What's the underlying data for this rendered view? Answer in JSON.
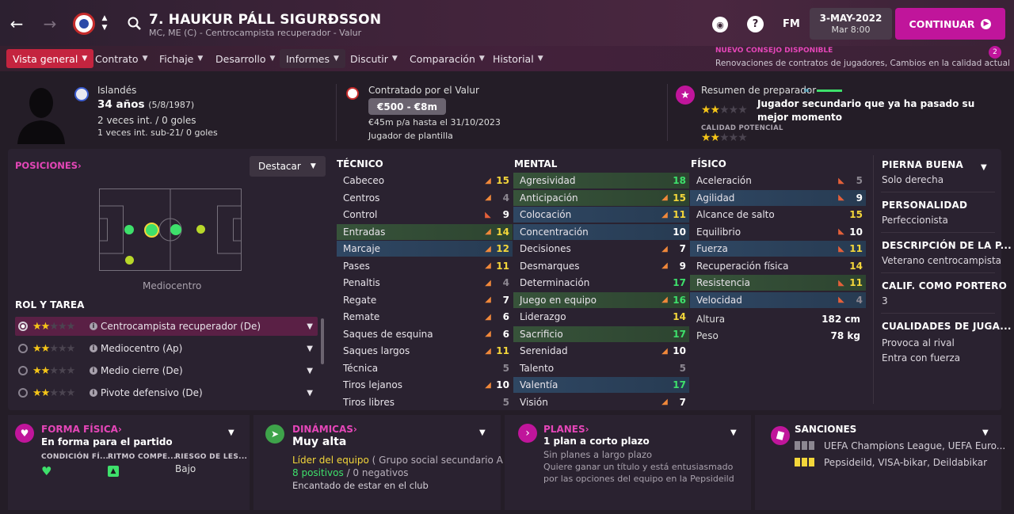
{
  "header": {
    "player_name": "7. HAUKUR PÁLL SIGURÐSSON",
    "subtitle": "MC, ME (C) - Centrocampista recuperador - Valur",
    "date": "3-MAY-2022",
    "time": "Mar 8:00",
    "fm_label": "FM",
    "continue_label": "CONTINUAR",
    "news_title": "NUEVO CONSEJO DISPONIBLE",
    "news_text": "Renovaciones de contratos de jugadores, Cambios en la calidad actual",
    "news_count": "2"
  },
  "nav": {
    "tabs": [
      "Vista general",
      "Contrato",
      "Fichaje",
      "Desarrollo",
      "Informes",
      "Discutir",
      "Comparación",
      "Historial"
    ]
  },
  "profile": {
    "nationality": "Islandés",
    "age": "34 años",
    "dob": "(5/8/1987)",
    "caps": "2 veces int. / 0 goles",
    "u21": "1 veces int. sub-21/ 0 goles"
  },
  "contract": {
    "club_line": "Contratado por el Valur",
    "value": "€500 - €8m",
    "wage": "€45m p/a hasta el 31/10/2023",
    "status": "Jugador de plantilla"
  },
  "coach": {
    "title": "Resumen de preparador",
    "summary": "Jugador secundario que ya ha pasado su mejor momento",
    "current_stars": 2,
    "potential_label": "CALIDAD POTENCIAL",
    "potential_stars": 2
  },
  "positions": {
    "title": "POSICIONES",
    "highlight_label": "Destacar",
    "position_name": "Mediocentro"
  },
  "roles": {
    "title": "ROL Y TAREA",
    "items": [
      {
        "name": "Centrocampista recuperador (De)",
        "stars": 2,
        "selected": true
      },
      {
        "name": "Mediocentro (Ap)",
        "stars": 2,
        "selected": false
      },
      {
        "name": "Medio cierre (De)",
        "stars": 2,
        "selected": false
      },
      {
        "name": "Pivote defensivo (De)",
        "stars": 2,
        "selected": false
      }
    ]
  },
  "technical": {
    "title": "TÉCNICO",
    "items": [
      {
        "name": "Cabeceo",
        "value": "15",
        "trend": "up",
        "hl": ""
      },
      {
        "name": "Centros",
        "value": "4",
        "trend": "up",
        "hl": ""
      },
      {
        "name": "Control",
        "value": "9",
        "trend": "down",
        "hl": ""
      },
      {
        "name": "Entradas",
        "value": "14",
        "trend": "up",
        "hl": "green"
      },
      {
        "name": "Marcaje",
        "value": "12",
        "trend": "up",
        "hl": "blue"
      },
      {
        "name": "Pases",
        "value": "11",
        "trend": "up",
        "hl": ""
      },
      {
        "name": "Penaltis",
        "value": "4",
        "trend": "up",
        "hl": ""
      },
      {
        "name": "Regate",
        "value": "7",
        "trend": "up",
        "hl": ""
      },
      {
        "name": "Remate",
        "value": "6",
        "trend": "up",
        "hl": ""
      },
      {
        "name": "Saques de esquina",
        "value": "6",
        "trend": "up",
        "hl": ""
      },
      {
        "name": "Saques largos",
        "value": "11",
        "trend": "up",
        "hl": ""
      },
      {
        "name": "Técnica",
        "value": "5",
        "trend": "",
        "hl": ""
      },
      {
        "name": "Tiros lejanos",
        "value": "10",
        "trend": "up",
        "hl": ""
      },
      {
        "name": "Tiros libres",
        "value": "5",
        "trend": "",
        "hl": ""
      }
    ]
  },
  "mental": {
    "title": "MENTAL",
    "items": [
      {
        "name": "Agresividad",
        "value": "18",
        "trend": "",
        "hl": "green"
      },
      {
        "name": "Anticipación",
        "value": "15",
        "trend": "up",
        "hl": "green"
      },
      {
        "name": "Colocación",
        "value": "11",
        "trend": "up",
        "hl": "blue"
      },
      {
        "name": "Concentración",
        "value": "10",
        "trend": "",
        "hl": "blue"
      },
      {
        "name": "Decisiones",
        "value": "7",
        "trend": "up",
        "hl": ""
      },
      {
        "name": "Desmarques",
        "value": "9",
        "trend": "up",
        "hl": ""
      },
      {
        "name": "Determinación",
        "value": "17",
        "trend": "",
        "hl": ""
      },
      {
        "name": "Juego en equipo",
        "value": "16",
        "trend": "up",
        "hl": "green"
      },
      {
        "name": "Liderazgo",
        "value": "14",
        "trend": "",
        "hl": ""
      },
      {
        "name": "Sacrificio",
        "value": "17",
        "trend": "",
        "hl": "green"
      },
      {
        "name": "Serenidad",
        "value": "10",
        "trend": "up",
        "hl": ""
      },
      {
        "name": "Talento",
        "value": "5",
        "trend": "",
        "hl": ""
      },
      {
        "name": "Valentía",
        "value": "17",
        "trend": "",
        "hl": "blue"
      },
      {
        "name": "Visión",
        "value": "7",
        "trend": "up",
        "hl": ""
      }
    ]
  },
  "physical": {
    "title": "FÍSICO",
    "items": [
      {
        "name": "Aceleración",
        "value": "5",
        "trend": "down",
        "hl": ""
      },
      {
        "name": "Agilidad",
        "value": "9",
        "trend": "down",
        "hl": "blue"
      },
      {
        "name": "Alcance de salto",
        "value": "15",
        "trend": "",
        "hl": ""
      },
      {
        "name": "Equilibrio",
        "value": "10",
        "trend": "down",
        "hl": ""
      },
      {
        "name": "Fuerza",
        "value": "11",
        "trend": "down",
        "hl": "blue"
      },
      {
        "name": "Recuperación física",
        "value": "14",
        "trend": "",
        "hl": ""
      },
      {
        "name": "Resistencia",
        "value": "11",
        "trend": "down",
        "hl": "green"
      },
      {
        "name": "Velocidad",
        "value": "4",
        "trend": "down",
        "hl": "blue"
      }
    ],
    "height_label": "Altura",
    "height": "182 cm",
    "weight_label": "Peso",
    "weight": "78 kg"
  },
  "side": {
    "foot_label": "PIERNA BUENA",
    "foot": "Solo derecha",
    "personality_label": "PERSONALIDAD",
    "personality": "Perfeccionista",
    "desc_label": "DESCRIPCIÓN DE LA P...",
    "desc": "Veterano centrocampista",
    "gk_label": "CALIF. COMO PORTERO",
    "gk": "3",
    "qualities_label": "CUALIDADES DE JUGA...",
    "qualities": [
      "Provoca al rival",
      "Entra con fuerza"
    ]
  },
  "fitness": {
    "title": "FORMA FÍSICA",
    "status": "En forma para el partido",
    "col1": "CONDICIÓN FÍ...",
    "col2": "RITMO COMPE...",
    "col3": "RIESGO DE LES...",
    "risk": "Bajo"
  },
  "dynamics": {
    "title": "DINÁMICAS",
    "level": "Muy alta",
    "leader": "Líder del equipo",
    "group": "( Grupo social secundario A )",
    "positives": "8 positivos",
    "negatives": "/ 0 negativos",
    "happy": "Encantado de estar en el club"
  },
  "plans": {
    "title": "PLANES",
    "short": "1 plan a corto plazo",
    "long": "Sin planes a largo plazo",
    "desc": "Quiere ganar un título y está entusiasmado por las opciones del equipo en la Pepsideild"
  },
  "sanctions": {
    "title": "SANCIONES",
    "line1": "UEFA Champions League, UEFA Euro...",
    "line2": "Pepsideild, VISA-bikar, Deildabikar"
  },
  "colors": {
    "accent": "#c0159b",
    "pink": "#e546b8",
    "green": "#3ee06b",
    "yellow": "#f3d63a"
  }
}
